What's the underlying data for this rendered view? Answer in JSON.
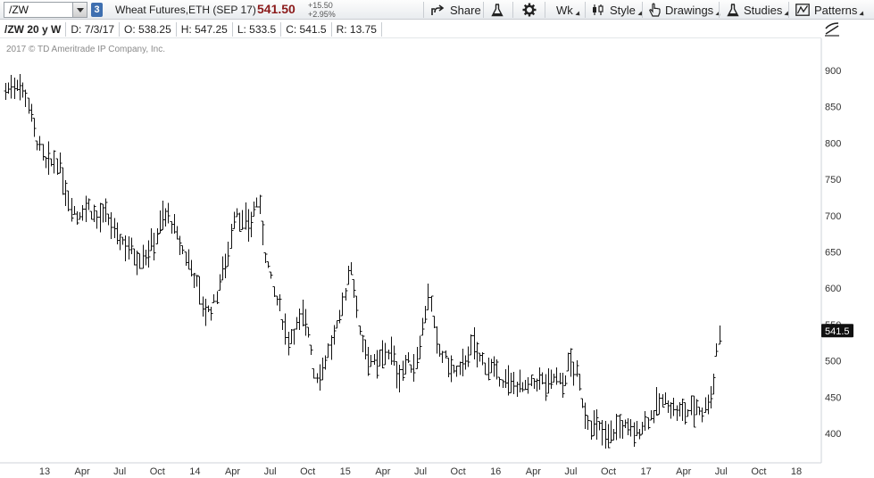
{
  "toolbar": {
    "symbol": "/ZW",
    "link_number": "3",
    "description": "Wheat Futures,ETH (SEP 17)",
    "last_price": "541.50",
    "net_change": "+15.50",
    "percent_change": "+2.95%",
    "buttons": {
      "share": "Share",
      "aggregation": "Wk",
      "style": "Style",
      "drawings": "Drawings",
      "studies": "Studies",
      "patterns": "Patterns"
    }
  },
  "info_bar": {
    "symbol": "/ZW 20 y W",
    "date": "D: 7/3/17",
    "open": "O: 538.25",
    "high": "H: 547.25",
    "low": "L: 533.5",
    "close": "C: 541.5",
    "range": "R: 13.75"
  },
  "copyright": "2017 © TD Ameritrade IP Company, Inc.",
  "price_marker": "541.5",
  "chart_data": {
    "type": "line",
    "style": "OHLC weekly bars",
    "y_ticks": [
      "900",
      "850",
      "800",
      "750",
      "700",
      "650",
      "600",
      "550",
      "500",
      "450",
      "400"
    ],
    "x_ticks": [
      "13",
      "Apr",
      "Jul",
      "Oct",
      "14",
      "Apr",
      "Jul",
      "Oct",
      "15",
      "Apr",
      "Jul",
      "Oct",
      "16",
      "Apr",
      "Jul",
      "Oct",
      "17",
      "Apr",
      "Jul",
      "Oct",
      "18"
    ],
    "ylim": [
      365,
      925
    ],
    "x_start": 2012.85,
    "x_end": 2018.0,
    "path_points": [
      [
        2012.85,
        872
      ],
      [
        2012.93,
        885
      ],
      [
        2013.0,
        860
      ],
      [
        2013.05,
        810
      ],
      [
        2013.12,
        770
      ],
      [
        2013.2,
        775
      ],
      [
        2013.27,
        725
      ],
      [
        2013.33,
        700
      ],
      [
        2013.4,
        715
      ],
      [
        2013.47,
        695
      ],
      [
        2013.53,
        700
      ],
      [
        2013.6,
        670
      ],
      [
        2013.67,
        660
      ],
      [
        2013.73,
        642
      ],
      [
        2013.8,
        648
      ],
      [
        2013.85,
        665
      ],
      [
        2013.9,
        695
      ],
      [
        2013.95,
        700
      ],
      [
        2014.0,
        672
      ],
      [
        2014.05,
        648
      ],
      [
        2014.1,
        630
      ],
      [
        2014.15,
        598
      ],
      [
        2014.2,
        565
      ],
      [
        2014.25,
        575
      ],
      [
        2014.3,
        615
      ],
      [
        2014.35,
        650
      ],
      [
        2014.4,
        712
      ],
      [
        2014.45,
        688
      ],
      [
        2014.5,
        690
      ],
      [
        2014.55,
        725
      ],
      [
        2014.6,
        650
      ],
      [
        2014.65,
        598
      ],
      [
        2014.7,
        570
      ],
      [
        2014.75,
        530
      ],
      [
        2014.8,
        545
      ],
      [
        2014.85,
        560
      ],
      [
        2014.9,
        535
      ],
      [
        2014.93,
        478
      ],
      [
        2014.97,
        485
      ],
      [
        2015.0,
        500
      ],
      [
        2015.05,
        525
      ],
      [
        2015.1,
        555
      ],
      [
        2015.15,
        610
      ],
      [
        2015.18,
        635
      ],
      [
        2015.22,
        560
      ],
      [
        2015.25,
        530
      ],
      [
        2015.3,
        505
      ],
      [
        2015.35,
        490
      ],
      [
        2015.4,
        515
      ],
      [
        2015.45,
        510
      ],
      [
        2015.5,
        478
      ],
      [
        2015.55,
        500
      ],
      [
        2015.6,
        490
      ],
      [
        2015.65,
        535
      ],
      [
        2015.7,
        595
      ],
      [
        2015.75,
        525
      ],
      [
        2015.8,
        505
      ],
      [
        2015.85,
        490
      ],
      [
        2015.9,
        480
      ],
      [
        2015.95,
        505
      ],
      [
        2016.0,
        520
      ],
      [
        2016.05,
        500
      ],
      [
        2016.1,
        495
      ],
      [
        2016.15,
        480
      ],
      [
        2016.2,
        475
      ],
      [
        2016.25,
        465
      ],
      [
        2016.3,
        470
      ],
      [
        2016.35,
        460
      ],
      [
        2016.4,
        468
      ],
      [
        2016.45,
        475
      ],
      [
        2016.5,
        465
      ],
      [
        2016.55,
        480
      ],
      [
        2016.6,
        465
      ],
      [
        2016.65,
        500
      ],
      [
        2016.7,
        480
      ],
      [
        2016.75,
        430
      ],
      [
        2016.8,
        410
      ],
      [
        2016.85,
        405
      ],
      [
        2016.9,
        395
      ],
      [
        2016.95,
        405
      ],
      [
        2017.0,
        410
      ],
      [
        2017.05,
        405
      ],
      [
        2017.1,
        400
      ],
      [
        2017.15,
        415
      ],
      [
        2017.2,
        425
      ],
      [
        2017.25,
        440
      ],
      [
        2017.3,
        445
      ],
      [
        2017.35,
        432
      ],
      [
        2017.4,
        428
      ],
      [
        2017.45,
        430
      ],
      [
        2017.5,
        438
      ],
      [
        2017.55,
        430
      ],
      [
        2017.6,
        455
      ],
      [
        2017.62,
        470
      ],
      [
        2017.64,
        520
      ],
      [
        2017.66,
        541.5
      ]
    ]
  }
}
